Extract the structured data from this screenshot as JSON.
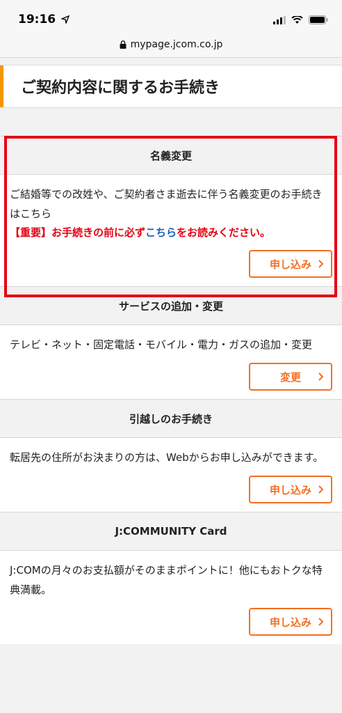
{
  "status": {
    "time": "19:16"
  },
  "browser": {
    "url": "mypage.jcom.co.jp"
  },
  "page": {
    "title": "ご契約内容に関するお手続き"
  },
  "sections": [
    {
      "title": "名義変更",
      "description": "ご結婚等での改姓や、ご契約者さま逝去に伴う名義変更のお手続きはこちら",
      "notice_prefix": "【重要】お手続きの前に必ず",
      "notice_link": "こちら",
      "notice_suffix": "をお読みください。",
      "button": "申し込み"
    },
    {
      "title": "サービスの追加・変更",
      "description": "テレビ・ネット・固定電話・モバイル・電力・ガスの追加・変更",
      "button": "変更"
    },
    {
      "title": "引越しのお手続き",
      "description": "転居先の住所がお決まりの方は、Webからお申し込みができます。",
      "button": "申し込み"
    },
    {
      "title": "J:COMMUNITY Card",
      "description": "J:COMの月々のお支払額がそのままポイントに！他にもおトクな特典満載。",
      "button": "申し込み"
    }
  ],
  "colors": {
    "accent": "#f39800",
    "button": "#f36f21",
    "alert": "#e60012",
    "link": "#1a5fb4"
  }
}
